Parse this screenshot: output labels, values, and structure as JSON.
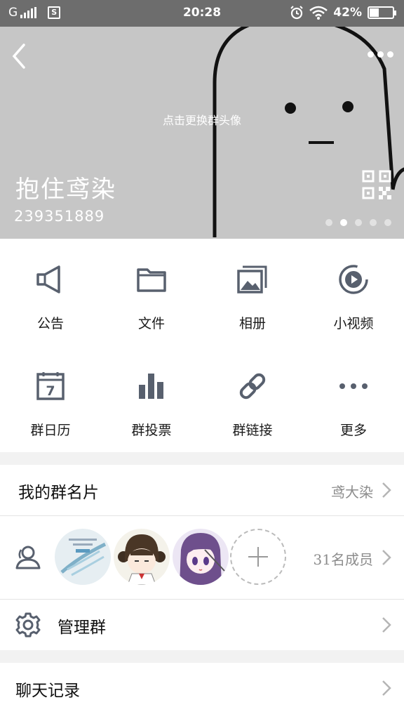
{
  "status_bar": {
    "carrier": "G",
    "sim_label": "S",
    "time": "20:28",
    "battery_text": "42%",
    "battery_level": 0.42
  },
  "header": {
    "change_avatar_text": "点击更换群头像",
    "group_name": "抱住鸢染",
    "group_id": "239351889",
    "page_count": 5,
    "active_page": 2
  },
  "features": [
    {
      "label": "公告",
      "icon": "megaphone-icon"
    },
    {
      "label": "文件",
      "icon": "folder-icon"
    },
    {
      "label": "相册",
      "icon": "album-icon"
    },
    {
      "label": "小视频",
      "icon": "video-play-icon"
    },
    {
      "label": "群日历",
      "icon": "calendar-icon"
    },
    {
      "label": "群投票",
      "icon": "bar-chart-icon"
    },
    {
      "label": "群链接",
      "icon": "link-icon"
    },
    {
      "label": "更多",
      "icon": "more-dots-icon"
    }
  ],
  "calendar_icon_day": "7",
  "my_card": {
    "title": "我的群名片",
    "value": "鸢大染"
  },
  "members": {
    "count_text": "31名成员"
  },
  "manage": {
    "title": "管理群"
  },
  "chat_history": {
    "title": "聊天记录"
  },
  "colors": {
    "icon_gray": "#58606e",
    "header_bg": "#c6c6c6",
    "status_bg": "#6d6d6d"
  }
}
